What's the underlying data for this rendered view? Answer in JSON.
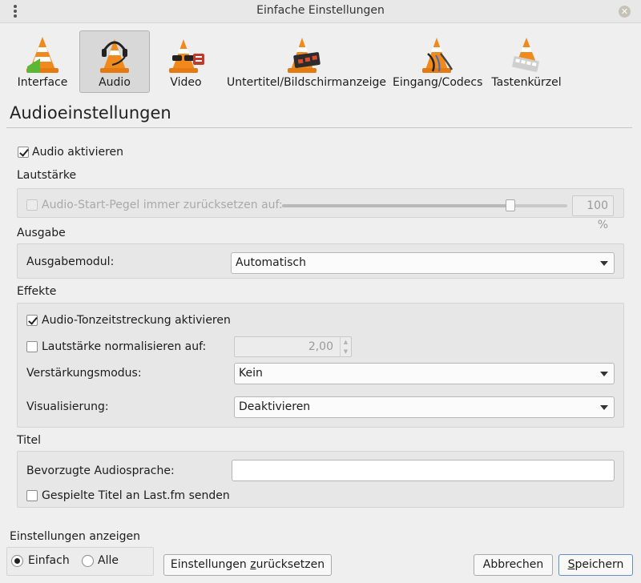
{
  "window": {
    "title": "Einfache Einstellungen"
  },
  "categories": [
    {
      "label": "Interface",
      "icon": "cone-interface-icon",
      "active": false
    },
    {
      "label": "Audio",
      "icon": "cone-headphones-icon",
      "active": true
    },
    {
      "label": "Video",
      "icon": "cone-glasses-icon",
      "active": false
    },
    {
      "label": "Untertitel/Bildschirmanzeige",
      "icon": "cone-subtitles-icon",
      "active": false
    },
    {
      "label": "Eingang/Codecs",
      "icon": "cone-cables-icon",
      "active": false
    },
    {
      "label": "Tastenkürzel",
      "icon": "cone-keyboard-icon",
      "active": false
    }
  ],
  "page": {
    "title": "Audioeinstellungen"
  },
  "audio_enable": {
    "label": "Audio aktivieren",
    "checked": true
  },
  "volume": {
    "section": "Lautstärke",
    "reset_label": "Audio-Start-Pegel immer zurücksetzen auf:",
    "reset_checked": false,
    "level_percent": 80,
    "value_text": "100 %"
  },
  "output": {
    "section": "Ausgabe",
    "module_label": "Ausgabemodul:",
    "module_value": "Automatisch"
  },
  "effects": {
    "section": "Effekte",
    "timestretch_label": "Audio-Tonzeitstreckung aktivieren",
    "timestretch_checked": true,
    "normalize_label": "Lautstärke normalisieren auf:",
    "normalize_checked": false,
    "normalize_value": "2,00",
    "gain_label": "Verstärkungsmodus:",
    "gain_value": "Kein",
    "visual_label": "Visualisierung:",
    "visual_value": "Deaktivieren"
  },
  "track": {
    "section": "Titel",
    "lang_label": "Bevorzugte Audiosprache:",
    "lang_value": "",
    "lastfm_label": "Gespielte Titel an Last.fm senden",
    "lastfm_checked": false
  },
  "footer": {
    "show_label": "Einstellungen anzeigen",
    "simple_label": "Einfach",
    "all_label": "Alle",
    "reset_pre": "Einstellungen ",
    "reset_key": "z",
    "reset_post": "urücksetzen",
    "cancel_label": "Abbrechen",
    "save_pre": "",
    "save_key": "S",
    "save_post": "peichern"
  }
}
